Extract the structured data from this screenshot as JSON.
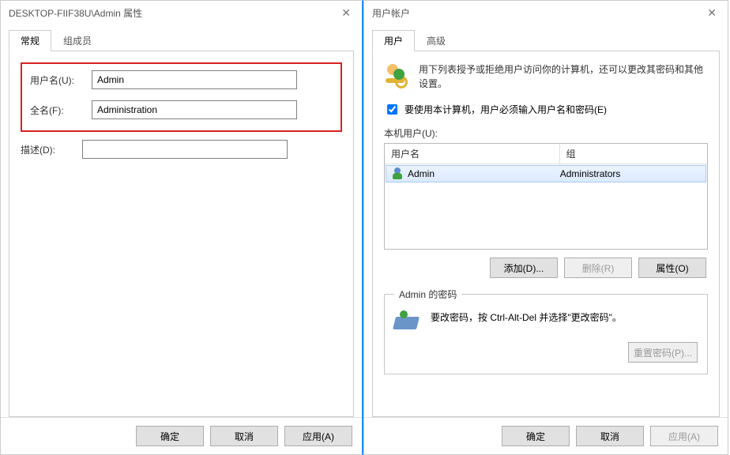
{
  "left": {
    "title": "DESKTOP-FIIF38U\\Admin 属性",
    "tabs": {
      "general": "常规",
      "members": "组成员"
    },
    "labels": {
      "username": "用户名(U):",
      "fullname": "全名(F):",
      "description": "描述(D):"
    },
    "values": {
      "username": "Admin",
      "fullname": "Administration",
      "description": ""
    },
    "buttons": {
      "ok": "确定",
      "cancel": "取消",
      "apply": "应用(A)"
    }
  },
  "right": {
    "title": "用户帐户",
    "tabs": {
      "users": "用户",
      "advanced": "高级"
    },
    "info": "用下列表授予或拒绝用户访问你的计算机，还可以更改其密码和其他设置。",
    "checkbox": "要使用本计算机，用户必须输入用户名和密码(E)",
    "listLabel": "本机用户(U):",
    "columns": {
      "user": "用户名",
      "group": "组"
    },
    "rows": [
      {
        "user": "Admin",
        "group": "Administrators"
      }
    ],
    "midButtons": {
      "add": "添加(D)...",
      "remove": "删除(R)",
      "props": "属性(O)"
    },
    "pwGroup": {
      "legend": "Admin 的密码",
      "text": "要改密码，按 Ctrl-Alt-Del 并选择\"更改密码\"。",
      "reset": "重置密码(P)..."
    },
    "buttons": {
      "ok": "确定",
      "cancel": "取消",
      "apply": "应用(A)"
    }
  }
}
